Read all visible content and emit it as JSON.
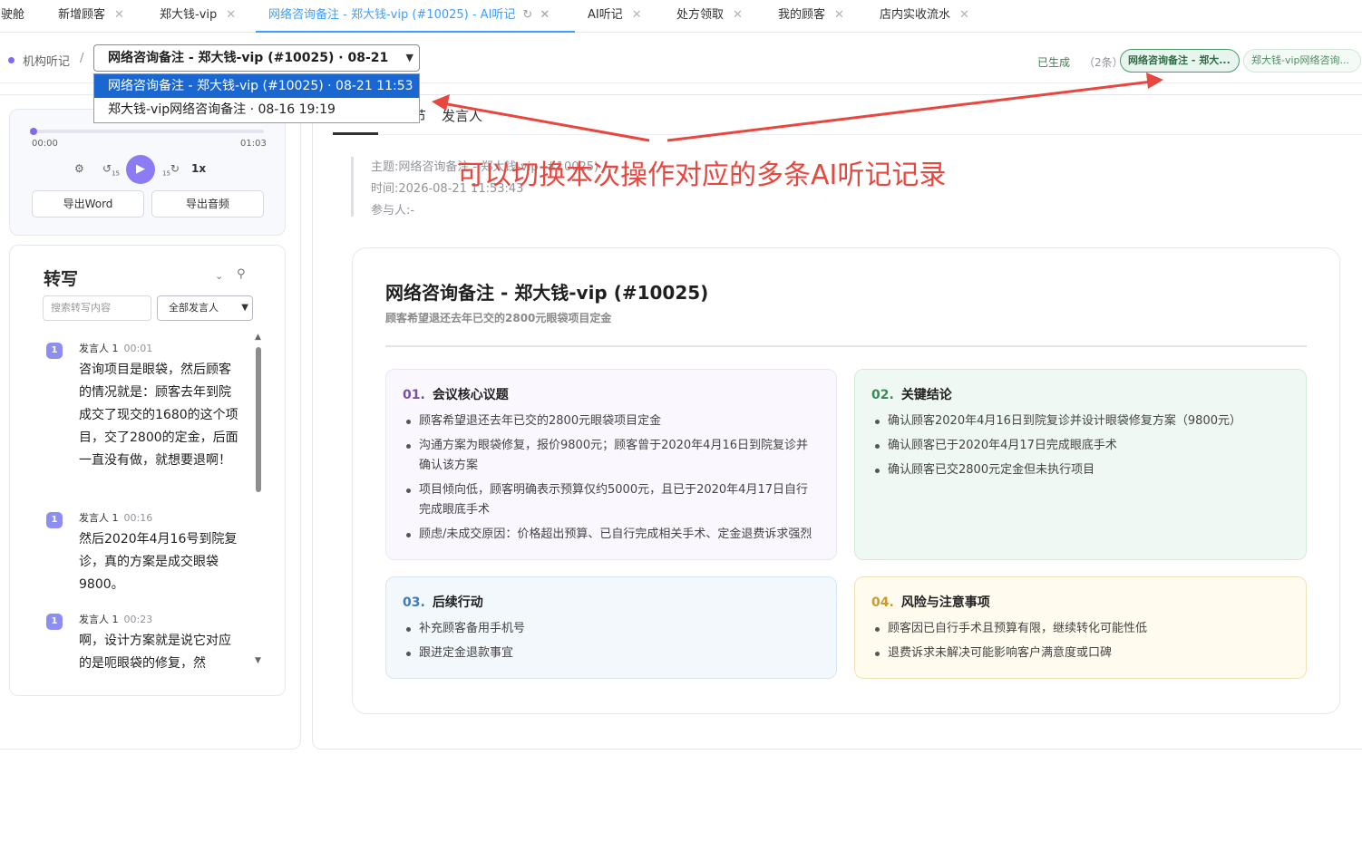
{
  "tabs": [
    {
      "label": "驾驶舱"
    },
    {
      "label": "新增顾客"
    },
    {
      "label": "郑大钱-vip"
    },
    {
      "label": "网络咨询备注 - 郑大钱-vip (#10025) - AI听记"
    },
    {
      "label": "AI听记"
    },
    {
      "label": "处方领取"
    },
    {
      "label": "我的顾客"
    },
    {
      "label": "店内实收流水"
    }
  ],
  "breadcrumb": {
    "root": "机构听记",
    "separator": "/"
  },
  "record_select": {
    "current": "网络咨询备注 - 郑大钱-vip (#10025) · 08-21",
    "options": [
      "网络咨询备注 - 郑大钱-vip (#10025) · 08-21 11:53",
      "郑大钱-vip网络咨询备注 · 08-16 19:19"
    ]
  },
  "generated": {
    "label": "已生成",
    "count": "（2条）",
    "chips": [
      "网络咨询备注 - 郑大...",
      "郑大钱-vip网络咨询..."
    ]
  },
  "player": {
    "time_start": "00:00",
    "time_end": "01:03",
    "progress": 0.0,
    "speed": "1x",
    "export_word": "导出Word",
    "export_audio": "导出音频"
  },
  "transcript": {
    "title": "转写",
    "search_placeholder": "搜索转写内容",
    "speaker_filter": "全部发言人",
    "items": [
      {
        "badge": "1",
        "speaker": "发言人 1",
        "time": "00:01",
        "text": "咨询项目是眼袋，然后顾客的情况就是：顾客去年到院成交了现交的1680的这个项目，交了2800的定金，后面一直没有做，就想要退啊！"
      },
      {
        "badge": "1",
        "speaker": "发言人 1",
        "time": "00:16",
        "text": "然后2020年4月16号到院复诊，真的方案是成交眼袋9800。"
      },
      {
        "badge": "1",
        "speaker": "发言人 1",
        "time": "00:23",
        "text": "啊，设计方案就是说它对应的是呃眼袋的修复，然"
      }
    ]
  },
  "main_tabs": [
    "节",
    "发言人"
  ],
  "meta": {
    "subject": "主题:网络咨询备注 - 郑大钱-vip (#10025)",
    "time": "时间:2026-08-21 11:53:43",
    "participants": "参与人:-"
  },
  "summary": {
    "title": "网络咨询备注 - 郑大钱-vip (#10025)",
    "subtitle": "顾客希望退还去年已交的2800元眼袋项目定金",
    "sections": [
      {
        "num": "01.",
        "title": "会议核心议题",
        "items": [
          "顾客希望退还去年已交的2800元眼袋项目定金",
          "沟通方案为眼袋修复，报价9800元；顾客曾于2020年4月16日到院复诊并确认该方案",
          "项目倾向低，顾客明确表示预算仅约5000元，且已于2020年4月17日自行完成眼底手术",
          "顾虑/未成交原因：价格超出预算、已自行完成相关手术、定金退费诉求强烈"
        ]
      },
      {
        "num": "02.",
        "title": "关键结论",
        "items": [
          "确认顾客2020年4月16日到院复诊并设计眼袋修复方案（9800元）",
          "确认顾客已于2020年4月17日完成眼底手术",
          "确认顾客已交2800元定金但未执行项目"
        ]
      },
      {
        "num": "03.",
        "title": "后续行动",
        "items": [
          "补充顾客备用手机号",
          "跟进定金退款事宜"
        ]
      },
      {
        "num": "04.",
        "title": "风险与注意事项",
        "items": [
          "顾客因已自行手术且预算有限，继续转化可能性低",
          "退费诉求未解决可能影响客户满意度或口碑"
        ]
      }
    ]
  },
  "annotation": "可以切换本次操作对应的多条AI听记记录",
  "colors": {
    "accent": "#409eff",
    "annotation": "#e8463e",
    "play": "#8b7cf4"
  }
}
